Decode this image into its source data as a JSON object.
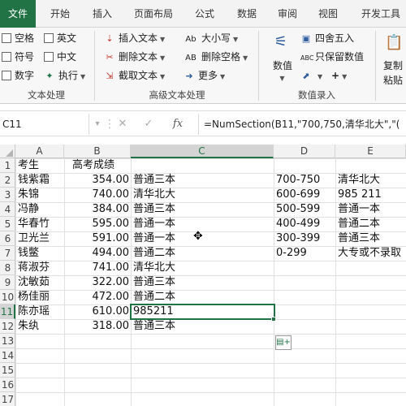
{
  "tabs": [
    "文件",
    "开始",
    "插入",
    "页面布局",
    "公式",
    "数据",
    "审阅",
    "视图",
    "开发工具"
  ],
  "ribbon": {
    "text_group": {
      "label": "文本处理",
      "items": [
        "空格",
        "英文",
        "符号",
        "中文",
        "数字",
        "执行"
      ]
    },
    "advanced_group": {
      "label": "高级文本处理",
      "items": [
        "插入文本",
        "删除文本",
        "截取文本",
        "大小写",
        "删除空格",
        "更多"
      ]
    },
    "numeric_group": {
      "label": "数值录入",
      "items": [
        "四舍五入",
        "只保留数值",
        "数值"
      ]
    },
    "paste_label": "复制粘贴"
  },
  "formula_bar": {
    "name_box": "C11",
    "formula": "=NumSection(B11,\"700,750,清华北大\",\"(",
    "fx": "fx"
  },
  "columns": [
    "A",
    "B",
    "C",
    "D",
    "E"
  ],
  "rows": [
    "1",
    "2",
    "3",
    "4",
    "5",
    "6",
    "7",
    "8",
    "9",
    "10",
    "11",
    "12",
    "13",
    "14",
    "15",
    "16",
    "17"
  ],
  "selected_cell": "C11",
  "sheet": {
    "header": {
      "name": "考生",
      "score": "高考成绩"
    },
    "students": [
      {
        "name": "钱紫霜",
        "score": "354.00",
        "result": "普通三本"
      },
      {
        "name": "朱锦",
        "score": "740.00",
        "result": "清华北大"
      },
      {
        "name": "冯静",
        "score": "384.00",
        "result": "普通三本"
      },
      {
        "name": "华春竹",
        "score": "595.00",
        "result": "普通一本"
      },
      {
        "name": "卫光兰",
        "score": "591.00",
        "result": "普通一本"
      },
      {
        "name": "钱鳖",
        "score": "494.00",
        "result": "普通二本"
      },
      {
        "name": "蒋淑芬",
        "score": "741.00",
        "result": "清华北大"
      },
      {
        "name": "沈敏茹",
        "score": "322.00",
        "result": "普通三本"
      },
      {
        "name": "杨佳丽",
        "score": "472.00",
        "result": "普通二本"
      },
      {
        "name": "陈亦瑶",
        "score": "610.00",
        "result": "985211"
      },
      {
        "name": "朱纨",
        "score": "318.00",
        "result": "普通三本"
      }
    ],
    "lookup": [
      {
        "range": "700-750",
        "label": "清华北大"
      },
      {
        "range": "600-699",
        "label": "985 211"
      },
      {
        "range": "500-599",
        "label": "普通一本"
      },
      {
        "range": "400-499",
        "label": "普通二本"
      },
      {
        "range": "300-399",
        "label": "普通三本"
      },
      {
        "range": "0-299",
        "label": "大专或不录取"
      }
    ]
  },
  "colors": {
    "accent": "#217346",
    "ribbon_bg": "#f7f7f7",
    "header_bg": "#f2f2f2"
  }
}
